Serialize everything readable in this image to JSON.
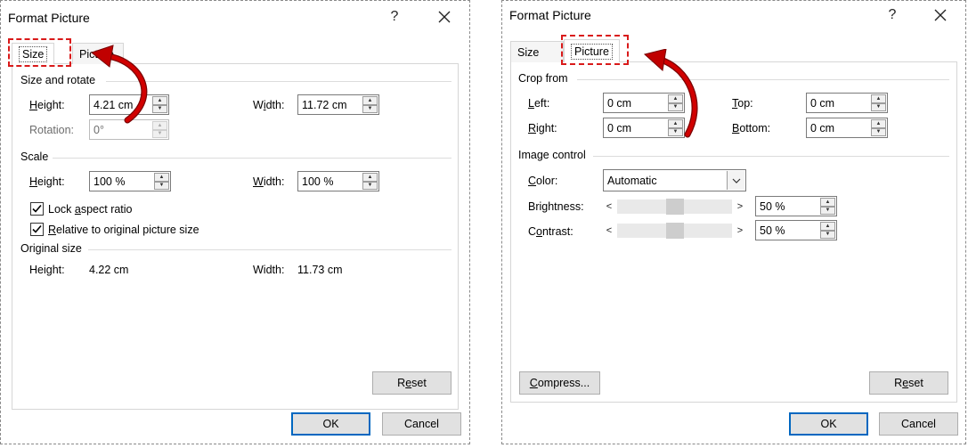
{
  "left_dialog": {
    "title": "Format Picture",
    "help": "?",
    "tabs": {
      "size": "Size",
      "picture": "Picture"
    },
    "size_and_rotate": {
      "heading": "Size and rotate",
      "height_label": "Height:",
      "height_value": "4.21 cm",
      "width_label": "Width:",
      "width_value": "11.72 cm",
      "rotation_label": "Rotation:",
      "rotation_value": "0°"
    },
    "scale": {
      "heading": "Scale",
      "height_label": "Height:",
      "height_value": "100 %",
      "width_label": "Width:",
      "width_value": "100 %",
      "lock_aspect_label": "Lock aspect ratio",
      "lock_aspect_checked": true,
      "relative_label": "Relative to original picture size",
      "relative_checked": true
    },
    "original_size": {
      "heading": "Original size",
      "height_label": "Height:",
      "height_value": "4.22 cm",
      "width_label": "Width:",
      "width_value": "11.73 cm"
    },
    "reset_label": "Reset",
    "ok_label": "OK",
    "cancel_label": "Cancel"
  },
  "right_dialog": {
    "title": "Format Picture",
    "help": "?",
    "tabs": {
      "size": "Size",
      "picture": "Picture"
    },
    "crop_from": {
      "heading": "Crop from",
      "left_label": "Left:",
      "left_value": "0 cm",
      "right_label": "Right:",
      "right_value": "0 cm",
      "top_label": "Top:",
      "top_value": "0 cm",
      "bottom_label": "Bottom:",
      "bottom_value": "0 cm"
    },
    "image_control": {
      "heading": "Image control",
      "color_label": "Color:",
      "color_value": "Automatic",
      "brightness_label": "Brightness:",
      "brightness_value": "50 %",
      "brightness_level": 0.5,
      "contrast_label": "Contrast:",
      "contrast_value": "50 %",
      "contrast_level": 0.5
    },
    "compress_label": "Compress...",
    "reset_label": "Reset",
    "ok_label": "OK",
    "cancel_label": "Cancel"
  },
  "colors": {
    "highlight": "#d91a1a",
    "arrow": "#c00000",
    "default_button_border": "#0067c0"
  },
  "icons": {
    "close": "close-icon",
    "spin_up": "spin-up-arrow-icon",
    "spin_down": "spin-down-arrow-icon",
    "dropdown": "chevron-down-icon",
    "check": "checkmark-icon",
    "annotation_arrow": "curved-arrow-icon"
  }
}
